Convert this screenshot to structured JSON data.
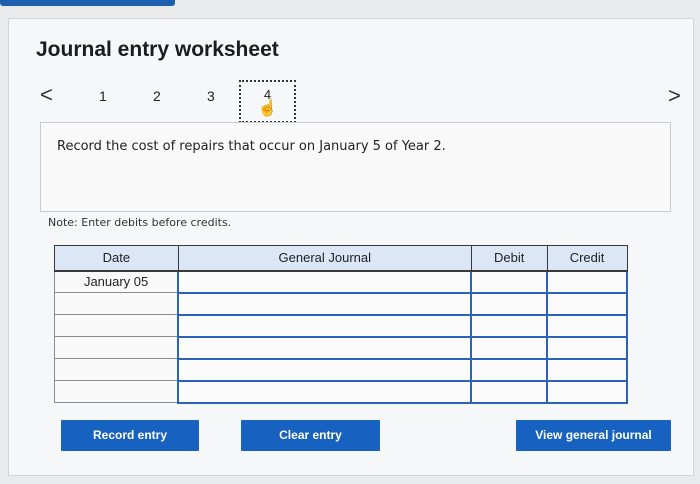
{
  "worksheet": {
    "title": "Journal entry worksheet",
    "nav": {
      "prev": "<",
      "next": ">"
    },
    "steps": [
      "1",
      "2",
      "3",
      "4"
    ],
    "current_step": "4",
    "question": "Record the cost of repairs that occur on January 5 of Year 2.",
    "note": "Note: Enter debits before credits."
  },
  "table": {
    "headers": {
      "date": "Date",
      "general_journal": "General Journal",
      "debit": "Debit",
      "credit": "Credit"
    },
    "rows": [
      {
        "date": "January 05",
        "account": "",
        "debit": "",
        "credit": ""
      },
      {
        "date": "",
        "account": "",
        "debit": "",
        "credit": ""
      },
      {
        "date": "",
        "account": "",
        "debit": "",
        "credit": ""
      },
      {
        "date": "",
        "account": "",
        "debit": "",
        "credit": ""
      },
      {
        "date": "",
        "account": "",
        "debit": "",
        "credit": ""
      },
      {
        "date": "",
        "account": "",
        "debit": "",
        "credit": ""
      }
    ]
  },
  "buttons": {
    "record": "Record entry",
    "clear": "Clear entry",
    "view": "View general journal"
  },
  "colors": {
    "accent": "#1762c0",
    "header_bg": "#dbe7f6"
  },
  "icons": {
    "current_step": "hand-pointer-icon"
  }
}
